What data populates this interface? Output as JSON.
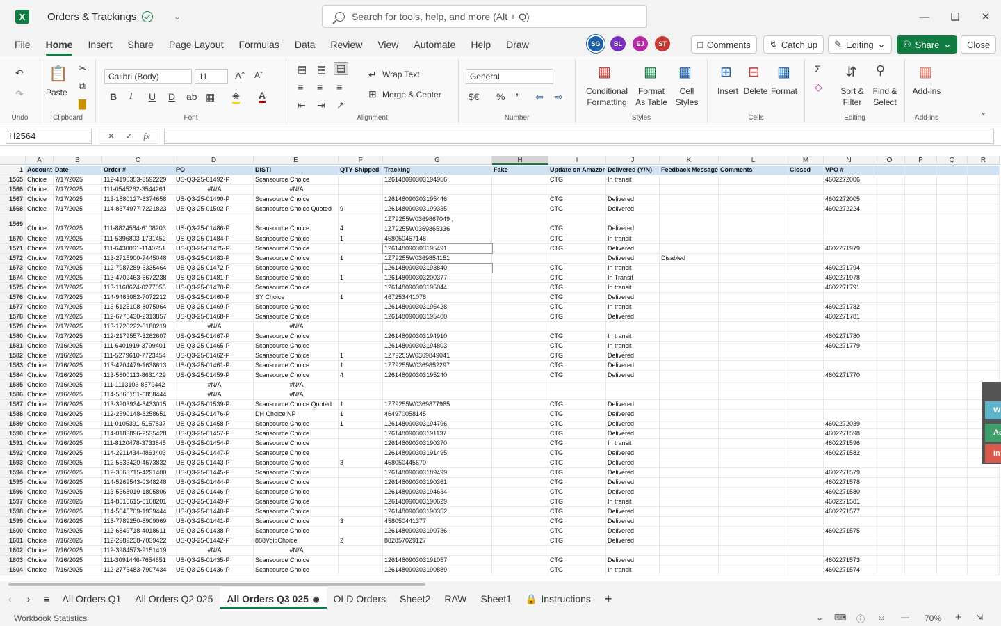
{
  "app": {
    "title": "Orders & Trackings",
    "logo": "X",
    "search_placeholder": "Search for tools, help, and more (Alt + Q)"
  },
  "menu": [
    "File",
    "Home",
    "Insert",
    "Share",
    "Page Layout",
    "Formulas",
    "Data",
    "Review",
    "View",
    "Automate",
    "Help",
    "Draw"
  ],
  "collaborators": [
    {
      "initials": "SG",
      "color": "#1b5fa8"
    },
    {
      "initials": "BL",
      "color": "#7b2fbf"
    },
    {
      "initials": "EJ",
      "color": "#b52aa6"
    },
    {
      "initials": "ST",
      "color": "#c43a32"
    }
  ],
  "actions": {
    "comments": "Comments",
    "catchup": "Catch up",
    "editing": "Editing",
    "share": "Share",
    "close": "Close"
  },
  "ribbon": {
    "undo_label": "Undo",
    "clipboard_label": "Clipboard",
    "paste": "Paste",
    "font_label": "Font",
    "font_name": "Calibri (Body)",
    "font_size": "11",
    "alignment_label": "Alignment",
    "wrap_text": "Wrap Text",
    "merge_center": "Merge & Center",
    "number_label": "Number",
    "number_format": "General",
    "styles_label": "Styles",
    "conditional_formatting": "Conditional Formatting",
    "format_as_table": "Format As Table",
    "cell_styles": "Cell Styles",
    "cells_label": "Cells",
    "insert": "Insert",
    "delete": "Delete",
    "format": "Format",
    "editing_label": "Editing",
    "sort_filter": "Sort & Filter",
    "find_select": "Find & Select",
    "addins": "Add-ins",
    "addins_label": "Add-ins"
  },
  "namebox": "H2564",
  "columns": [
    "A",
    "B",
    "C",
    "D",
    "E",
    "F",
    "G",
    "H",
    "I",
    "J",
    "K",
    "L",
    "M",
    "N",
    "O",
    "P",
    "Q",
    "R"
  ],
  "headers": [
    "Account",
    "Date",
    "Order #",
    "PO",
    "DISTI",
    "QTY Shipped",
    "Tracking",
    "Fake",
    "Update on Amazon",
    "Delivered (Y/N)",
    "Feedback Message",
    "Comments",
    "Closed",
    "VPO #",
    "",
    "",
    "",
    ""
  ],
  "rows": [
    [
      "1565",
      "Choice",
      "7/17/2025",
      "112-4190353-3592229",
      "US-Q3-25-01492-P",
      "Scansource Choice",
      "",
      "126148090303194956",
      "",
      "CTG",
      "In transit",
      "",
      "",
      "",
      "4602272006"
    ],
    [
      "1566",
      "Choice",
      "7/17/2025",
      "111-0545262-3544261",
      "#N/A",
      "#N/A",
      "",
      "",
      "",
      "",
      "",
      "",
      "",
      "",
      ""
    ],
    [
      "1567",
      "Choice",
      "7/17/2025",
      "113-1880127-6374658",
      "US-Q3-25-01490-P",
      "Scansource Choice",
      "",
      "126148090303195446",
      "",
      "CTG",
      "Delivered",
      "",
      "",
      "",
      "4602272005"
    ],
    [
      "1568",
      "Choice",
      "7/17/2025",
      "114-8674977-7221823",
      "US-Q3-25-01502-P",
      "Scansource Choice Quoted",
      "9",
      "126148090303199335",
      "",
      "CTG",
      "Delivered",
      "",
      "",
      "",
      "4602272224"
    ],
    [
      "1569",
      "Choice",
      "7/17/2025",
      "111-8824584-6108203",
      "US-Q3-25-01486-P",
      "Scansource Choice",
      "4",
      "1Z79255W0369865336",
      "",
      "CTG",
      "Delivered",
      "",
      "",
      "",
      ""
    ],
    [
      "1570",
      "Choice",
      "7/17/2025",
      "111-5396803-1731452",
      "US-Q3-25-01484-P",
      "Scansource Choice",
      "1",
      "458050457148",
      "",
      "CTG",
      "In transit",
      "",
      "",
      "",
      ""
    ],
    [
      "1571",
      "Choice",
      "7/17/2025",
      "111-6430061-1140251",
      "US-Q3-25-01475-P",
      "Scansource Choice",
      "",
      "126148090303195491",
      "",
      "CTG",
      "Delivered",
      "",
      "",
      "",
      "4602271979"
    ],
    [
      "1572",
      "Choice",
      "7/17/2025",
      "113-2715900-7445048",
      "US-Q3-25-01483-P",
      "Scansource Choice",
      "1",
      "1Z79255W0369854151",
      "",
      "",
      "Delivered",
      "Disabled",
      "",
      "",
      ""
    ],
    [
      "1573",
      "Choice",
      "7/17/2025",
      "112-7987289-3335464",
      "US-Q3-25-01472-P",
      "Scansource Choice",
      "",
      "126148090303193840",
      "",
      "CTG",
      "In transit",
      "",
      "",
      "",
      "4602271794"
    ],
    [
      "1574",
      "Choice",
      "7/17/2025",
      "113-4702463-6672238",
      "US-Q3-25-01481-P",
      "Scansource Choice",
      "1",
      "126148090303200377",
      "",
      "CTG",
      "In Transit",
      "",
      "",
      "",
      "4602271978"
    ],
    [
      "1575",
      "Choice",
      "7/17/2025",
      "113-1168624-0277055",
      "US-Q3-25-01470-P",
      "Scansource Choice",
      "",
      "126148090303195044",
      "",
      "CTG",
      "In transit",
      "",
      "",
      "",
      "4602271791"
    ],
    [
      "1576",
      "Choice",
      "7/17/2025",
      "114-9463082-7072212",
      "US-Q3-25-01460-P",
      "SY Choice",
      "1",
      "467253441078",
      "",
      "CTG",
      "Delivered",
      "",
      "",
      "",
      ""
    ],
    [
      "1577",
      "Choice",
      "7/17/2025",
      "113-5125108-8075064",
      "US-Q3-25-01469-P",
      "Scansource Choice",
      "",
      "126148090303195428",
      "",
      "CTG",
      "In transit",
      "",
      "",
      "",
      "4602271782"
    ],
    [
      "1578",
      "Choice",
      "7/17/2025",
      "112-6775430-2313857",
      "US-Q3-25-01468-P",
      "Scansource Choice",
      "",
      "126148090303195400",
      "",
      "CTG",
      "Delivered",
      "",
      "",
      "",
      "4602271781"
    ],
    [
      "1579",
      "Choice",
      "7/17/2025",
      "113-1720222-0180219",
      "#N/A",
      "#N/A",
      "",
      "",
      "",
      "",
      "",
      "",
      "",
      "",
      ""
    ],
    [
      "1580",
      "Choice",
      "7/17/2025",
      "112-2179557-3262607",
      "US-Q3-25-01467-P",
      "Scansource Choice",
      "",
      "126148090303194910",
      "",
      "CTG",
      "In transit",
      "",
      "",
      "",
      "4602271780"
    ],
    [
      "1581",
      "Choice",
      "7/16/2025",
      "111-6401919-3799401",
      "US-Q3-25-01465-P",
      "Scansource Choice",
      "",
      "126148090303194803",
      "",
      "CTG",
      "In transit",
      "",
      "",
      "",
      "4602271779"
    ],
    [
      "1582",
      "Choice",
      "7/16/2025",
      "111-5279610-7723454",
      "US-Q3-25-01462-P",
      "Scansource Choice",
      "1",
      "1Z79255W0369849041",
      "",
      "CTG",
      "Delivered",
      "",
      "",
      "",
      ""
    ],
    [
      "1583",
      "Choice",
      "7/16/2025",
      "113-4204479-1638613",
      "US-Q3-25-01461-P",
      "Scansource Choice",
      "1",
      "1Z79255W0369852297",
      "",
      "CTG",
      "Delivered",
      "",
      "",
      "",
      ""
    ],
    [
      "1584",
      "Choice",
      "7/16/2025",
      "113-5600113-8631429",
      "US-Q3-25-01459-P",
      "Scansource Choice",
      "4",
      "126148090303195240",
      "",
      "CTG",
      "Delivered",
      "",
      "",
      "",
      "4602271770"
    ],
    [
      "1585",
      "Choice",
      "7/16/2025",
      "111-1113103-8579442",
      "#N/A",
      "#N/A",
      "",
      "",
      "",
      "",
      "",
      "",
      "",
      "",
      ""
    ],
    [
      "1586",
      "Choice",
      "7/16/2025",
      "114-5866151-6858444",
      "#N/A",
      "#N/A",
      "",
      "",
      "",
      "",
      "",
      "",
      "",
      "",
      ""
    ],
    [
      "1587",
      "Choice",
      "7/16/2025",
      "113-3903934-3433015",
      "US-Q3-25-01539-P",
      "Scansource Choice Quoted",
      "1",
      "1Z79255W0369877985",
      "",
      "CTG",
      "Delivered",
      "",
      "",
      "",
      ""
    ],
    [
      "1588",
      "Choice",
      "7/16/2025",
      "112-2590148-8258651",
      "US-Q3-25-01476-P",
      "DH Choice NP",
      "1",
      "464970058145",
      "",
      "CTG",
      "Delivered",
      "",
      "",
      "",
      ""
    ],
    [
      "1589",
      "Choice",
      "7/16/2025",
      "111-0105391-5157837",
      "US-Q3-25-01458-P",
      "Scansource Choice",
      "1",
      "126148090303194796",
      "",
      "CTG",
      "Delivered",
      "",
      "",
      "",
      "4602272039"
    ],
    [
      "1590",
      "Choice",
      "7/16/2025",
      "114-0183896-2535428",
      "US-Q3-25-01457-P",
      "Scansource Choice",
      "",
      "126148090303191137",
      "",
      "CTG",
      "Delivered",
      "",
      "",
      "",
      "4602271598"
    ],
    [
      "1591",
      "Choice",
      "7/16/2025",
      "111-8120478-3733845",
      "US-Q3-25-01454-P",
      "Scansource Choice",
      "",
      "126148090303190370",
      "",
      "CTG",
      "In transit",
      "",
      "",
      "",
      "4602271596"
    ],
    [
      "1592",
      "Choice",
      "7/16/2025",
      "114-2911434-4863403",
      "US-Q3-25-01447-P",
      "Scansource Choice",
      "",
      "126148090303191495",
      "",
      "CTG",
      "Delivered",
      "",
      "",
      "",
      "4602271582"
    ],
    [
      "1593",
      "Choice",
      "7/16/2025",
      "112-5533420-4673832",
      "US-Q3-25-01443-P",
      "Scansource Choice",
      "3",
      "458050445670",
      "",
      "CTG",
      "Delivered",
      "",
      "",
      "",
      ""
    ],
    [
      "1594",
      "Choice",
      "7/16/2025",
      "112-3063715-4291400",
      "US-Q3-25-01445-P",
      "Scansource Choice",
      "",
      "126148090303189499",
      "",
      "CTG",
      "Delivered",
      "",
      "",
      "",
      "4602271579"
    ],
    [
      "1595",
      "Choice",
      "7/16/2025",
      "114-5269543-0348248",
      "US-Q3-25-01444-P",
      "Scansource Choice",
      "",
      "126148090303190361",
      "",
      "CTG",
      "Delivered",
      "",
      "",
      "",
      "4602271578"
    ],
    [
      "1596",
      "Choice",
      "7/16/2025",
      "113-5368019-1805806",
      "US-Q3-25-01446-P",
      "Scansource Choice",
      "",
      "126148090303194634",
      "",
      "CTG",
      "Delivered",
      "",
      "",
      "",
      "4602271580"
    ],
    [
      "1597",
      "Choice",
      "7/16/2025",
      "114-8516615-8108201",
      "US-Q3-25-01449-P",
      "Scansource Choice",
      "",
      "126148090303190629",
      "",
      "CTG",
      "In transit",
      "",
      "",
      "",
      "4602271581"
    ],
    [
      "1598",
      "Choice",
      "7/16/2025",
      "114-5645709-1939444",
      "US-Q3-25-01440-P",
      "Scansource Choice",
      "",
      "126148090303190352",
      "",
      "CTG",
      "Delivered",
      "",
      "",
      "",
      "4602271577"
    ],
    [
      "1599",
      "Choice",
      "7/16/2025",
      "113-7789250-8909069",
      "US-Q3-25-01441-P",
      "Scansource Choice",
      "3",
      "458050441377",
      "",
      "CTG",
      "Delivered",
      "",
      "",
      "",
      ""
    ],
    [
      "1600",
      "Choice",
      "7/16/2025",
      "112-6849718-4018611",
      "US-Q3-25-01438-P",
      "Scansource Choice",
      "",
      "126148090303190736",
      "",
      "CTG",
      "Delivered",
      "",
      "",
      "",
      "4602271575"
    ],
    [
      "1601",
      "Choice",
      "7/16/2025",
      "112-2989238-7039422",
      "US-Q3-25-01442-P",
      "888VoipChoice",
      "2",
      "882857029127",
      "",
      "CTG",
      "Delivered",
      "",
      "",
      "",
      ""
    ],
    [
      "1602",
      "Choice",
      "7/16/2025",
      "112-3984573-9151419",
      "#N/A",
      "#N/A",
      "",
      "",
      "",
      "",
      "",
      "",
      "",
      "",
      ""
    ],
    [
      "1603",
      "Choice",
      "7/16/2025",
      "111-3091446-7654651",
      "US-Q3-25-01435-P",
      "Scansource Choice",
      "",
      "126148090303191057",
      "",
      "CTG",
      "Delivered",
      "",
      "",
      "",
      "4602271573"
    ],
    [
      "1604",
      "Choice",
      "7/16/2025",
      "112-2776483-7907434",
      "US-Q3-25-01436-P",
      "Scansource Choice",
      "",
      "126148090303190889",
      "",
      "CTG",
      "In transit",
      "",
      "",
      "",
      "4602271574"
    ]
  ],
  "row1569_extra": "1Z79255W0369867049 ,",
  "sidepanel_tabs": [
    "W",
    "Ac",
    "In"
  ],
  "sheets": [
    "All Orders Q1",
    "All Orders Q2 025",
    "All Orders Q3 025",
    "OLD Orders",
    "Sheet2",
    "RAW",
    "Sheet1",
    "Instructions"
  ],
  "active_sheet": "All Orders Q3 025",
  "status": {
    "left": "Workbook Statistics",
    "zoom": "70%"
  }
}
